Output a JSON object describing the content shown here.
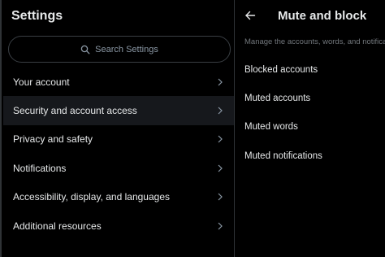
{
  "settings": {
    "title": "Settings",
    "search_placeholder": "Search Settings",
    "menu": [
      {
        "label": "Your account"
      },
      {
        "label": "Security and account access"
      },
      {
        "label": "Privacy and safety"
      },
      {
        "label": "Notifications"
      },
      {
        "label": "Accessibility, display, and languages"
      },
      {
        "label": "Additional resources"
      }
    ],
    "active_index": 1
  },
  "detail": {
    "title": "Mute and block",
    "description": "Manage the accounts, words, and notifications",
    "options": [
      {
        "label": "Blocked accounts"
      },
      {
        "label": "Muted accounts"
      },
      {
        "label": "Muted words"
      },
      {
        "label": "Muted notifications"
      }
    ]
  },
  "icons": {
    "search": "search-icon",
    "chevron": "chevron-right-icon",
    "back": "back-arrow-icon"
  },
  "colors": {
    "background": "#000000",
    "active_row": "#16181c",
    "text_primary": "#e7e9ea",
    "text_secondary": "#71767b",
    "border": "#2f3336"
  }
}
